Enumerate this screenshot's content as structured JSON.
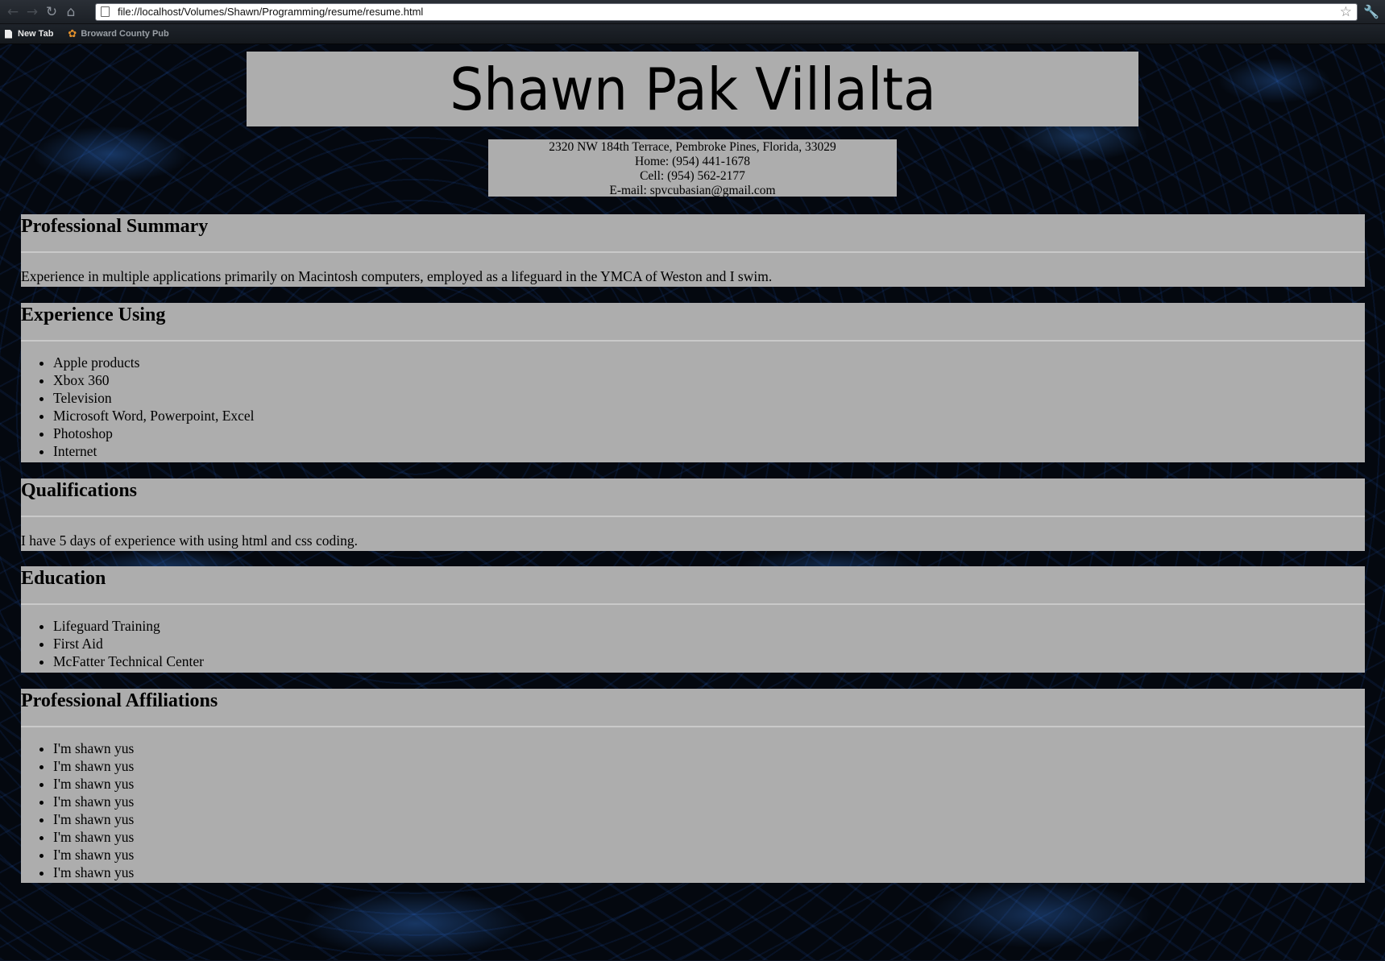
{
  "browser": {
    "url": "file://localhost/Volumes/Shawn/Programming/resume/resume.html",
    "bookmarks": [
      {
        "label": "New Tab"
      },
      {
        "label": "Broward County Pub"
      }
    ]
  },
  "resume": {
    "name": "Shawn Pak Villalta",
    "contact": {
      "address": "2320 NW 184th Terrace, Pembroke Pines, Florida, 33029",
      "home": "Home: (954) 441-1678",
      "cell": "Cell: (954) 562-2177",
      "email": "E-mail: spvcubasian@gmail.com"
    },
    "summary": {
      "heading": "Professional Summary",
      "text": "Experience in multiple applications primarily on Macintosh computers, employed as a lifeguard in the YMCA of Weston and I swim."
    },
    "experience": {
      "heading": "Experience Using",
      "items": [
        "Apple products",
        "Xbox 360",
        "Television",
        "Microsoft Word, Powerpoint, Excel",
        "Photoshop",
        "Internet"
      ]
    },
    "qualifications": {
      "heading": "Qualifications",
      "text": "I have 5 days of experience with using html and css coding."
    },
    "education": {
      "heading": "Education",
      "items": [
        "Lifeguard Training",
        "First Aid",
        "McFatter Technical Center"
      ]
    },
    "affiliations": {
      "heading": "Professional Affiliations",
      "items": [
        "I'm shawn yus",
        "I'm shawn yus",
        "I'm shawn yus",
        "I'm shawn yus",
        "I'm shawn yus",
        "I'm shawn yus",
        "I'm shawn yus",
        "I'm shawn yus"
      ]
    }
  }
}
